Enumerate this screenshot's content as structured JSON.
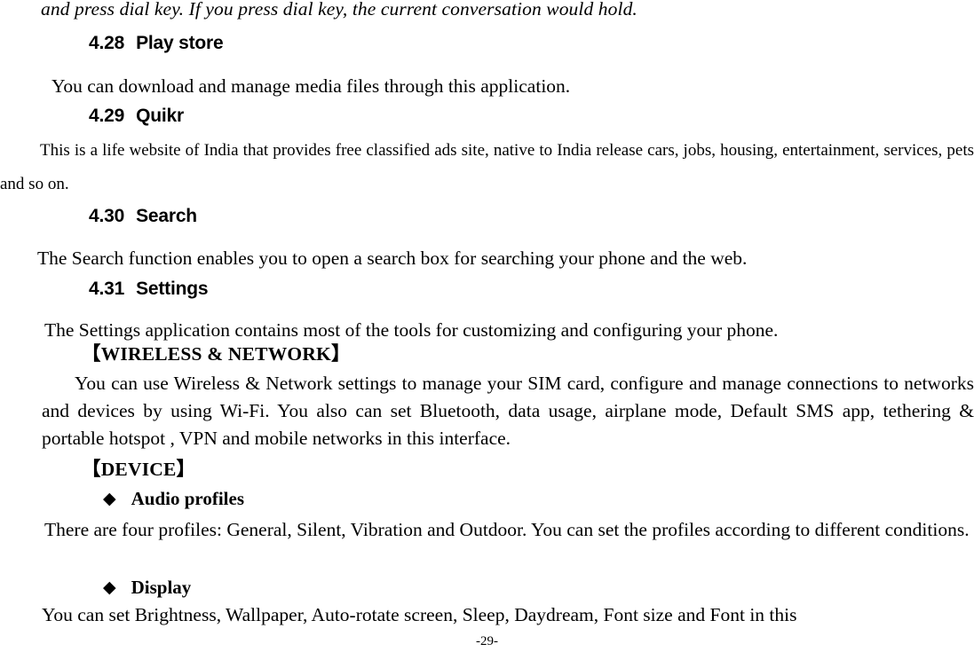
{
  "document": {
    "page_number_label": "-29-",
    "continuation_text": "and press dial key. If you press dial key, the current conversation would hold.",
    "sections": [
      {
        "number": "4.28",
        "title": "Play store",
        "body": "You can download and manage media files through this application."
      },
      {
        "number": "4.29",
        "title": "Quikr",
        "body": "This is a life website of India that provides free classified ads site, native to India release cars, jobs, housing, entertainment, services, pets and so on."
      },
      {
        "number": "4.30",
        "title": "Search",
        "body": "The Search function enables you to open a search box for searching your phone and the web."
      },
      {
        "number": "4.31",
        "title": "Settings",
        "body": "The Settings application contains most of the tools for customizing and configuring your phone."
      }
    ],
    "subsections": [
      {
        "heading": "【WIRELESS & NETWORK】",
        "body": "You can use Wireless & Network settings to manage your SIM card, configure and manage connections to networks and devices by using Wi-Fi. You also can set Bluetooth, data usage, airplane mode, Default SMS app, tethering & portable hotspot , VPN and mobile networks in this interface."
      },
      {
        "heading": "【DEVICE】"
      }
    ],
    "bullets": [
      {
        "marker": "◆",
        "label": "Audio profiles",
        "body": "There are four profiles: General, Silent, Vibration and Outdoor. You can set the profiles according to different conditions."
      },
      {
        "marker": "◆",
        "label": "Display",
        "body": "You can set Brightness, Wallpaper, Auto-rotate screen, Sleep, Daydream, Font size and Font in this"
      }
    ]
  }
}
